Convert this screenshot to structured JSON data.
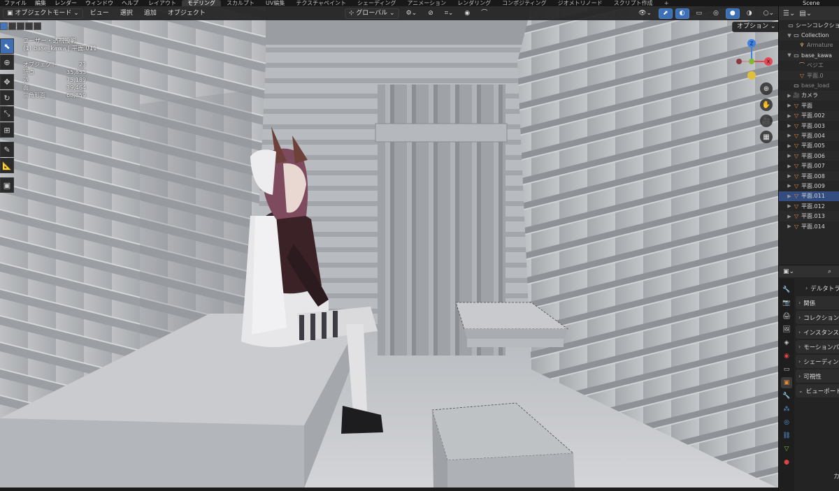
{
  "menubar": {
    "menus": [
      "ファイル",
      "編集",
      "レンダー",
      "ウィンドウ",
      "ヘルプ"
    ],
    "workspaces": [
      "レイアウト",
      "モデリング",
      "スカルプト",
      "UV編集",
      "テクスチャペイント",
      "シェーディング",
      "アニメーション",
      "レンダリング",
      "コンポジティング",
      "ジオメトリノード",
      "スクリプト作成"
    ],
    "active_workspace": "モデリング",
    "add_workspace": "+",
    "scene": "Scene"
  },
  "viewport_header": {
    "mode": "オブジェクトモード",
    "menus": [
      "ビュー",
      "選択",
      "追加",
      "オブジェクト"
    ],
    "transform_orientation": "グローバル",
    "options": "オプション"
  },
  "viewport_info": {
    "view_name": "ユーザー・透視投影",
    "object_line": "(1) base_kawa | 平面.011",
    "stats": [
      {
        "label": "オブジェクト",
        "value": "23"
      },
      {
        "label": "頂点",
        "value": "35,853"
      },
      {
        "label": "辺",
        "value": "75,189"
      },
      {
        "label": "面",
        "value": "39,464"
      },
      {
        "label": "三角形面",
        "value": "68,859"
      }
    ]
  },
  "gizmo": {
    "x": "X",
    "y": "Y",
    "z": "Z",
    "x_color": "#e54754",
    "y_color": "#7fb92e",
    "z_color": "#3f82e6"
  },
  "outliner": {
    "title": "シーンコレクション",
    "rows": [
      {
        "label": "シーンコレクション",
        "icon": "collection-icon",
        "indent": 0,
        "arrow": ""
      },
      {
        "label": "Collection",
        "icon": "collection-icon",
        "indent": 1,
        "arrow": "▼"
      },
      {
        "label": "Armature",
        "icon": "armature-icon",
        "indent": 2,
        "arrow": "",
        "dim": true
      },
      {
        "label": "base_kawa",
        "icon": "collection-icon",
        "indent": 1,
        "arrow": "▼"
      },
      {
        "label": "ベジエ",
        "icon": "curve-icon",
        "indent": 2,
        "arrow": "",
        "dim": true
      },
      {
        "label": "平面.0",
        "icon": "mesh-icon",
        "indent": 2,
        "arrow": "",
        "dim": true
      },
      {
        "label": "base_load",
        "icon": "collection-icon",
        "indent": 1,
        "arrow": "",
        "dim": true
      },
      {
        "label": "カメラ",
        "icon": "camera-icon",
        "indent": 1,
        "arrow": "▶"
      },
      {
        "label": "平面",
        "icon": "mesh-icon",
        "indent": 1,
        "arrow": "▶"
      },
      {
        "label": "平面.002",
        "icon": "mesh-icon",
        "indent": 1,
        "arrow": "▶"
      },
      {
        "label": "平面.003",
        "icon": "mesh-icon",
        "indent": 1,
        "arrow": "▶"
      },
      {
        "label": "平面.004",
        "icon": "mesh-icon",
        "indent": 1,
        "arrow": "▶"
      },
      {
        "label": "平面.005",
        "icon": "mesh-icon",
        "indent": 1,
        "arrow": "▶"
      },
      {
        "label": "平面.006",
        "icon": "mesh-icon",
        "indent": 1,
        "arrow": "▶"
      },
      {
        "label": "平面.007",
        "icon": "mesh-icon",
        "indent": 1,
        "arrow": "▶"
      },
      {
        "label": "平面.008",
        "icon": "mesh-icon",
        "indent": 1,
        "arrow": "▶"
      },
      {
        "label": "平面.009",
        "icon": "mesh-icon",
        "indent": 1,
        "arrow": "▶"
      },
      {
        "label": "平面.011",
        "icon": "mesh-icon",
        "indent": 1,
        "arrow": "▶",
        "selected": true
      },
      {
        "label": "平面.012",
        "icon": "mesh-icon",
        "indent": 1,
        "arrow": "▶"
      },
      {
        "label": "平面.013",
        "icon": "mesh-icon",
        "indent": 1,
        "arrow": "▶"
      },
      {
        "label": "平面.014",
        "icon": "mesh-icon",
        "indent": 1,
        "arrow": "▶"
      }
    ]
  },
  "properties": {
    "sections": [
      {
        "label": "デルタトランスフォーム",
        "sub": true
      },
      {
        "label": "関係"
      },
      {
        "label": "コレクション"
      },
      {
        "label": "インスタンス化"
      },
      {
        "label": "モーションパス"
      },
      {
        "label": "シェーディング"
      },
      {
        "label": "可視性"
      },
      {
        "label": "ビューポート表示",
        "open": true
      }
    ],
    "bottom_label": "カ"
  },
  "colors": {
    "accent": "#3f6fb3",
    "selected_row": "#334d80",
    "mesh_icon": "#e48a3a"
  }
}
